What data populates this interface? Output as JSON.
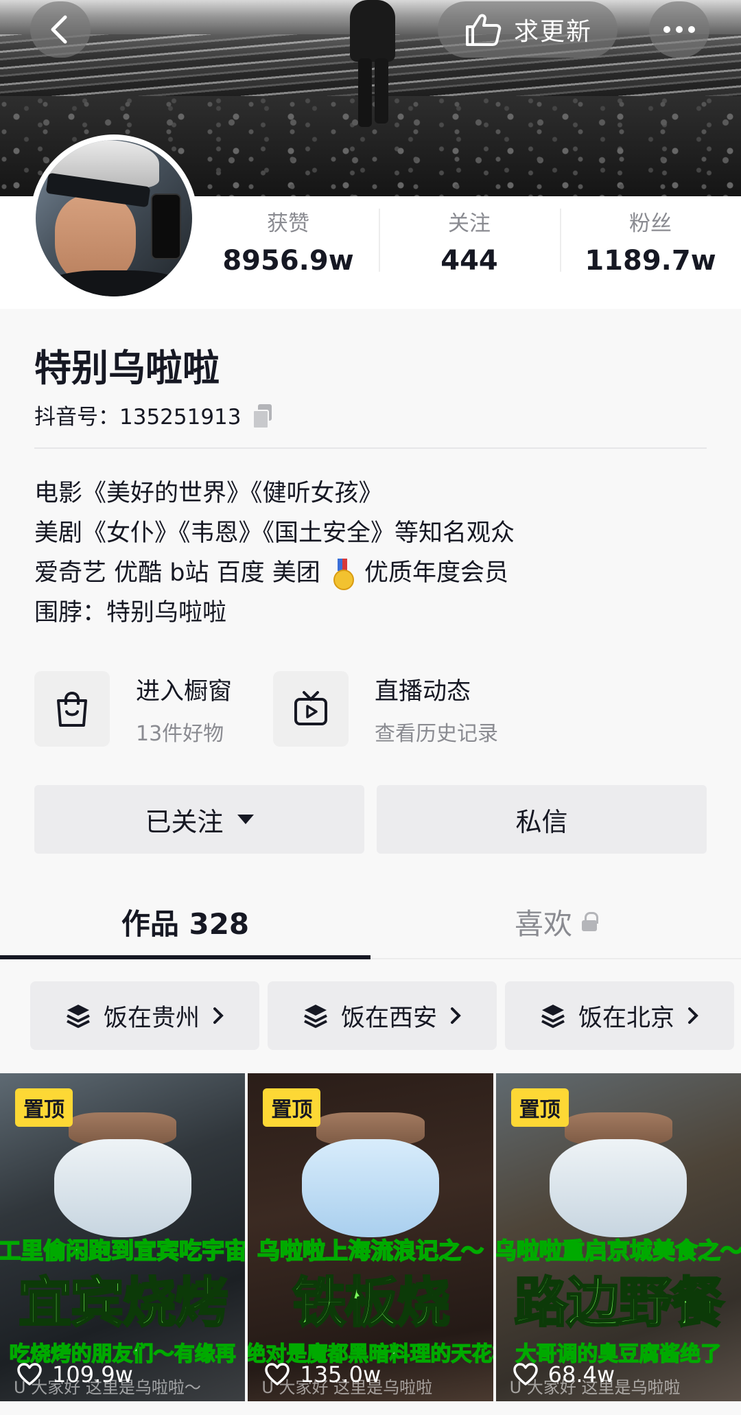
{
  "header": {
    "update_label": "求更新"
  },
  "stats": [
    {
      "label": "获赞",
      "value": "8956.9w"
    },
    {
      "label": "关注",
      "value": "444"
    },
    {
      "label": "粉丝",
      "value": "1189.7w"
    }
  ],
  "profile": {
    "name": "特别乌啦啦",
    "douyin_id": "抖音号：135251913",
    "bio": {
      "line1": "电影《美好的世界》《健听女孩》",
      "line2": "美剧《女仆》《韦恩》《国土安全》等知名观众",
      "line3_before": "爱奇艺 优酷 b站 百度 美团",
      "line3_after": "优质年度会员",
      "line4": "围脖：特别乌啦啦"
    }
  },
  "entries": [
    {
      "title": "进入橱窗",
      "subtitle": "13件好物",
      "icon": "shopping-bag-icon"
    },
    {
      "title": "直播动态",
      "subtitle": "查看历史记录",
      "icon": "tv-icon"
    }
  ],
  "actions": {
    "follow_label": "已关注",
    "message_label": "私信"
  },
  "tabs": {
    "works": "作品 328",
    "likes": "喜欢"
  },
  "collections": [
    {
      "label": "饭在贵州"
    },
    {
      "label": "饭在西安"
    },
    {
      "label": "饭在北京"
    }
  ],
  "videos": [
    {
      "badge": "置顶",
      "cap_top": "工里偷闲跑到宜宾吃宇宙",
      "cap_main": "宜宾烧烤",
      "cap_bottom": "吃烧烤的朋友们～有缘再",
      "subtitle": "U 大家好 这里是乌啦啦～",
      "likes": "109.9w"
    },
    {
      "badge": "置顶",
      "cap_top": "乌啦啦上海流浪记之～",
      "cap_main": "铁板烧",
      "cap_bottom": "绝对是魔都黑暗料理的天花板",
      "subtitle": "U 大家好 这里是乌啦啦",
      "likes": "135.0w"
    },
    {
      "badge": "置顶",
      "cap_top": "乌啦啦重启京城美食之～",
      "cap_main": "路边野餐",
      "cap_bottom": "大哥调的臭豆腐酱绝了",
      "subtitle": "U 大家好 这里是乌啦啦",
      "likes": "68.4w"
    }
  ],
  "colors": {
    "text_primary": "#161823",
    "text_secondary": "#8a8b91",
    "pin_badge": "#fdd835",
    "caption_green": "#7cff5c"
  }
}
